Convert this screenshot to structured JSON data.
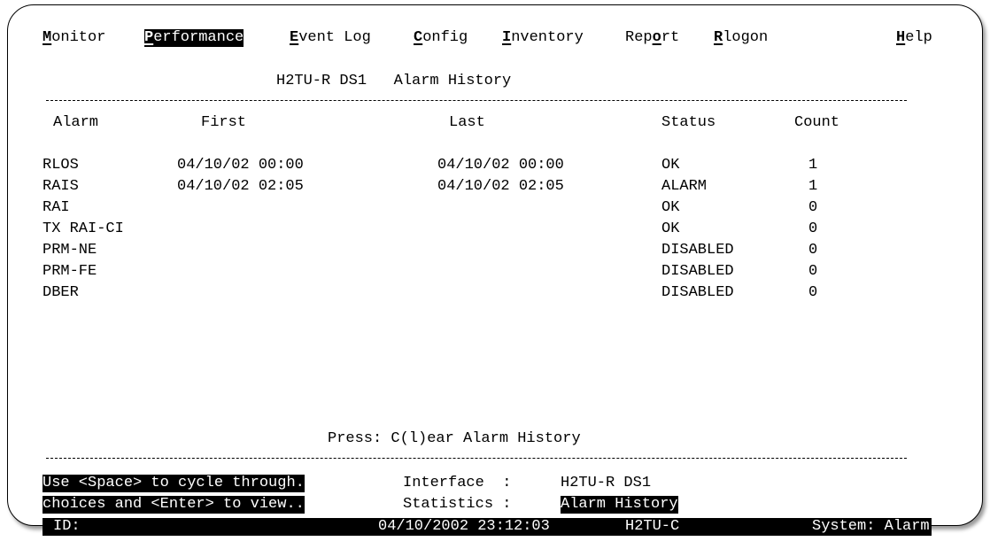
{
  "menu": {
    "items": [
      {
        "hot": "M",
        "rest": "onitor"
      },
      {
        "hot": "P",
        "rest": "erformance"
      },
      {
        "hot": "E",
        "rest": "vent Log"
      },
      {
        "hot": "C",
        "rest": "onfig"
      },
      {
        "hot": "I",
        "rest": "nventory"
      },
      {
        "pre": "Rep",
        "hot": "o",
        "rest": "rt"
      },
      {
        "hot": "R",
        "rest": "logon"
      },
      {
        "hot": "H",
        "rest": "elp"
      }
    ]
  },
  "title": "H2TU-R DS1   Alarm History",
  "table": {
    "headers": {
      "alarm": "Alarm",
      "first": "First",
      "last": "Last",
      "status": "Status",
      "count": "Count"
    },
    "rows": [
      {
        "alarm": "RLOS",
        "first": "04/10/02 00:00",
        "last": "04/10/02 00:00",
        "status": "OK",
        "count": "1"
      },
      {
        "alarm": "RAIS",
        "first": "04/10/02 02:05",
        "last": "04/10/02 02:05",
        "status": "ALARM",
        "count": "1"
      },
      {
        "alarm": "RAI",
        "first": "",
        "last": "",
        "status": "OK",
        "count": "0"
      },
      {
        "alarm": "TX RAI-CI",
        "first": "",
        "last": "",
        "status": "OK",
        "count": "0"
      },
      {
        "alarm": "PRM-NE",
        "first": "",
        "last": "",
        "status": "DISABLED",
        "count": "0"
      },
      {
        "alarm": "PRM-FE",
        "first": "",
        "last": "",
        "status": "DISABLED",
        "count": "0"
      },
      {
        "alarm": "DBER",
        "first": "",
        "last": "",
        "status": "DISABLED",
        "count": "0"
      }
    ]
  },
  "press_prompt": "Press: C(l)ear Alarm History",
  "help": {
    "line1": "Use <Space> to cycle through.",
    "line2": "choices and <Enter> to view.."
  },
  "fields": {
    "interface_label": "Interface  :",
    "interface_value": "H2TU-R DS1",
    "statistics_label": "Statistics :",
    "statistics_value": "Alarm History"
  },
  "status_bar": {
    "id_label": "ID:",
    "datetime": "04/10/2002 23:12:03",
    "unit": "H2TU-C",
    "system": "System: Alarm"
  },
  "colors": {
    "background": "#ffffff",
    "foreground": "#000000",
    "highlight": "#000000"
  }
}
